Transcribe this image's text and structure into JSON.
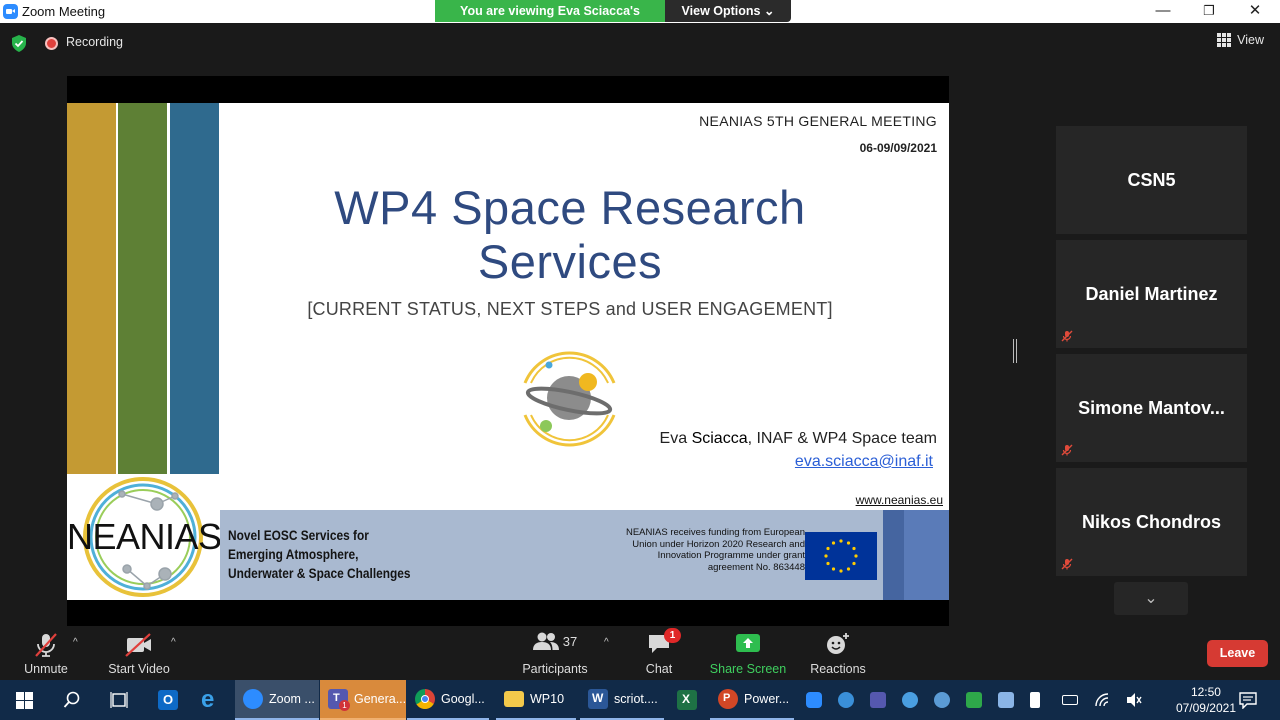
{
  "window": {
    "title": "Zoom Meeting",
    "min_glyph": "—",
    "restore_glyph": "❐",
    "close_glyph": "✕"
  },
  "banner": {
    "viewing_text": "You are viewing Eva Sciacca's screen",
    "view_options": "View Options ⌄"
  },
  "topbar": {
    "recording_label": "Recording",
    "view_label": "View"
  },
  "slide": {
    "meeting_name": "NEANIAS 5TH GENERAL MEETING",
    "meeting_date": "06-09/09/2021",
    "title_line1": "WP4 Space Research",
    "title_line2": "Services",
    "subtitle": "[CURRENT STATUS, NEXT STEPS and USER ENGAGEMENT]",
    "author_prefix": "Eva ",
    "author_name": "Sciacca",
    "author_suffix": ", INAF & WP4 Space team",
    "email": "eva.sciacca@inaf.it",
    "website": "www.neanias.eu",
    "logo_word": "NEANIAS",
    "tagline": "Novel EOSC Services for Emerging Atmosphere, Underwater & Space Challenges",
    "funding": "NEANIAS receives funding from European Union under Horizon 2020 Research and Innovation Programme under grant agreement No. 863448",
    "stripe_colors": [
      "#c49a33",
      "#5e8035",
      "#2f6a8e"
    ]
  },
  "participants_panel": {
    "tiles": [
      {
        "name": "CSN5",
        "muted": false
      },
      {
        "name": "Daniel Martinez",
        "muted": true
      },
      {
        "name": "Simone  Mantov...",
        "muted": true
      },
      {
        "name": "Nikos Chondros",
        "muted": true
      }
    ],
    "scroll_glyph": "⌄"
  },
  "controls": {
    "unmute": "Unmute",
    "start_video": "Start Video",
    "participants": "Participants",
    "participants_count": "37",
    "chat": "Chat",
    "chat_badge": "1",
    "share_screen": "Share Screen",
    "reactions": "Reactions",
    "leave": "Leave",
    "caret": "^"
  },
  "taskbar": {
    "items": [
      {
        "label": "Zoom ...",
        "state": "active"
      },
      {
        "label": "Genera...",
        "state": "orange"
      },
      {
        "label": "Googl...",
        "state": "underline"
      },
      {
        "label": "WP10",
        "state": "underline"
      },
      {
        "label": "scriot....",
        "state": "underline"
      },
      {
        "label": "Power...",
        "state": "underline"
      }
    ],
    "teams_badge": "1",
    "time": "12:50",
    "date": "07/09/2021"
  },
  "colors": {
    "zoom_blue": "#2d8cff",
    "share_green": "#39b54a",
    "leave_red": "#d63a33",
    "slide_title_blue": "#2f4a80",
    "taskbar": "#112a48"
  }
}
